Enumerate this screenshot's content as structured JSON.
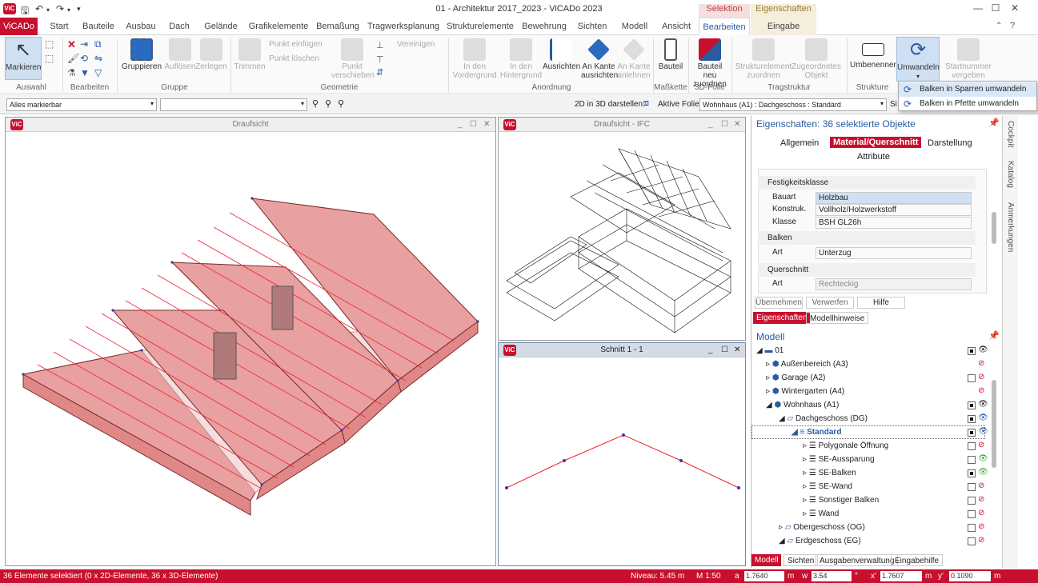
{
  "window": {
    "title": "01 - Architektur 2017_2023 - ViCADo 2023",
    "logo": "ViC"
  },
  "tabs": [
    "ViCADo",
    "Start",
    "Bauteile",
    "Ausbau",
    "Dach",
    "Gelände",
    "Grafikelemente",
    "Bemaßung",
    "Tragwerksplanung",
    "Strukturelemente",
    "Bewehrung",
    "Sichten",
    "Modell",
    "Ansicht",
    "Bearbeiten",
    "Eingabe"
  ],
  "context_tabs": {
    "selektion": "Selektion",
    "eigenschaften": "Eigenschaften"
  },
  "ribbon": {
    "auswahl": {
      "markieren": "Markieren",
      "group": "Auswahl"
    },
    "bearbeiten": {
      "group": "Bearbeiten"
    },
    "gruppe": {
      "gruppieren": "Gruppieren",
      "aufloesen": "Auflösen",
      "zerlegen": "Zerlegen",
      "group": "Gruppe"
    },
    "geometrie": {
      "trimmen": "Trimmen",
      "punkt_einfuegen": "Punkt einfügen",
      "punkt_loeschen": "Punkt löschen",
      "punkt_verschieben": "Punkt verschieben",
      "vereinigen": "Vereinigen",
      "group": "Geometrie"
    },
    "anordnung": {
      "vordergrund": "In den Vordergrund",
      "hintergrund": "In den Hintergrund",
      "ausrichten": "Ausrichten",
      "an_kante_ausrichten": "An Kante ausrichten",
      "an_kante_anlehnen": "An Kante anlehnen",
      "group": "Anordnung"
    },
    "masskette": {
      "bauteil": "Bauteil",
      "group": "Maßkette"
    },
    "folie": {
      "neu_zuordnen": "Bauteil neu zuordnen",
      "group": "3D-Folie"
    },
    "tragstruktur": {
      "strukturelement": "Strukturelement zuordnen",
      "zugeordnetes": "Zugeordnetes Objekt",
      "group": "Tragstruktur"
    },
    "strukture": {
      "umbenennen": "Umbenennen",
      "umwandeln": "Umwandeln",
      "startnummer": "Startnummer vergeben",
      "group": "Strukture"
    }
  },
  "dropdown": [
    "Balken in Sparren umwandeln",
    "Balken in Pfette umwandeln"
  ],
  "optionbar": {
    "filter": "Alles markierbar",
    "field2": "",
    "label_2d3d": "2D in 3D darstellen:",
    "label_folie": "Aktive Folie:",
    "folie": "Wohnhaus (A1) : Dachgeschoss : Standard",
    "si": "Si"
  },
  "views": {
    "draufsicht": "Draufsicht",
    "draufsicht_ifc": "Draufsicht - IFC",
    "schnitt": "Schnitt 1 - 1"
  },
  "properties": {
    "title": "Eigenschaften: 36 selektierte Objekte",
    "tabs": [
      "Allgemein",
      "Material/Querschnitt",
      "Darstellung",
      "Attribute"
    ],
    "sections": {
      "festigkeit": "Festigkeitsklasse",
      "balken": "Balken",
      "querschnitt": "Querschnitt"
    },
    "rows": [
      {
        "label": "Bauart",
        "value": "Holzbau"
      },
      {
        "label": "Konstruk.",
        "value": "Vollholz/Holzwerkstoff"
      },
      {
        "label": "Klasse",
        "value": "BSH GL26h"
      },
      {
        "label": "Art",
        "value": "Unterzug"
      },
      {
        "label": "Art",
        "value": "Rechteckig"
      }
    ],
    "buttons": {
      "uebernehmen": "Übernehmen",
      "verwerfen": "Verwerfen",
      "hilfe": "Hilfe"
    },
    "bottom_tabs": [
      "Eigenschaften",
      "Modellhinweise"
    ]
  },
  "model": {
    "title": "Modell",
    "items": [
      "01",
      "Außenbereich (A3)",
      "Garage (A2)",
      "Wintergarten (A4)",
      "Wohnhaus (A1)",
      "Dachgeschoss (DG)",
      "Standard",
      "Polygonale Öffnung",
      "SE-Aussparung",
      "SE-Balken",
      "SE-Wand",
      "Sonstiger Balken",
      "Wand",
      "Obergeschoss (OG)",
      "Erdgeschoss (EG)"
    ],
    "bottom_tabs": [
      "Modell",
      "Sichten",
      "Ausgabenverwaltung",
      "Eingabehilfe"
    ]
  },
  "side_tabs": [
    "Cockpit",
    "Katalog",
    "Anmerkungen"
  ],
  "status": {
    "text": "36 Elemente selektiert (0 x 2D-Elemente, 36 x 3D-Elemente)",
    "niveau": "Niveau: 5.45 m",
    "mass": "M 1:50",
    "a_label": "a",
    "a": "1.7640",
    "m1": "m",
    "w_label": "w",
    "w": "3.54",
    "deg": "°",
    "x_label": "x'",
    "x": "1.7607",
    "m2": "m",
    "y_label": "y'",
    "y": "0.1090",
    "m3": "m"
  },
  "colors": {
    "brand": "#c8102e",
    "accent": "#2a5aa0",
    "roof": "#e8a0a0"
  }
}
